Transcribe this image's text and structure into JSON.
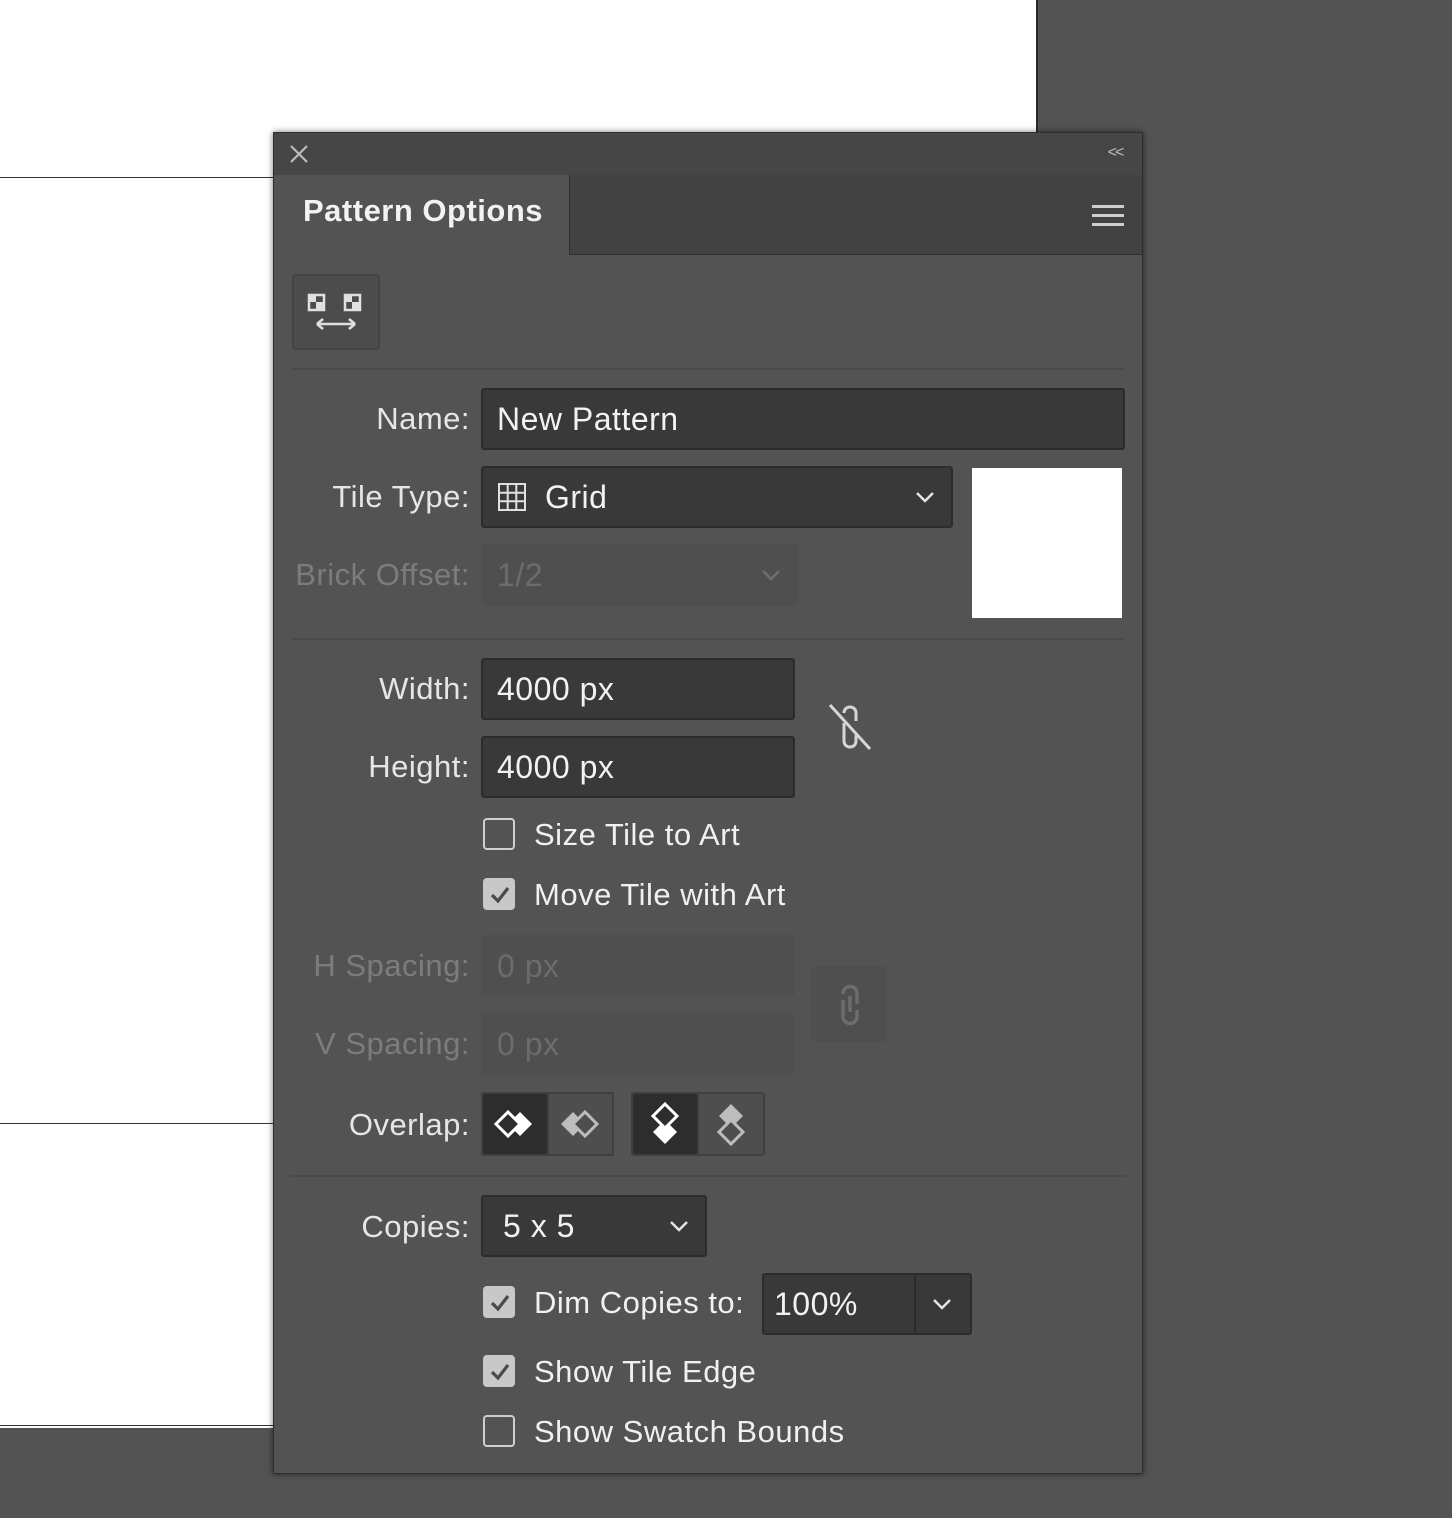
{
  "panel": {
    "title": "Pattern Options",
    "collapse_glyph": "<<",
    "icons": {
      "close": "close-icon",
      "menu": "hamburger-menu-icon",
      "tile_editor": "pattern-tile-tool-icon",
      "tile_type": "grid-icon",
      "size_link": "unlink-chain-icon",
      "spacing_link": "link-chain-icon"
    }
  },
  "form": {
    "name_label": "Name:",
    "name_value": "New Pattern",
    "tile_type_label": "Tile Type:",
    "tile_type_value": "Grid",
    "brick_offset_label": "Brick Offset:",
    "brick_offset_value": "1/2",
    "width_label": "Width:",
    "width_value": "4000 px",
    "height_label": "Height:",
    "height_value": "4000 px",
    "size_tile_to_art": {
      "label": "Size Tile to Art",
      "checked": false
    },
    "move_tile_with_art": {
      "label": "Move Tile with Art",
      "checked": true
    },
    "h_spacing_label": "H Spacing:",
    "h_spacing_value": "0 px",
    "v_spacing_label": "V Spacing:",
    "v_spacing_value": "0 px",
    "overlap_label": "Overlap:",
    "copies_label": "Copies:",
    "copies_value": "5 x 5",
    "dim_copies": {
      "label": "Dim Copies to:",
      "checked": true,
      "value": "100%"
    },
    "show_tile_edge": {
      "label": "Show Tile Edge",
      "checked": true
    },
    "show_swatch_bounds": {
      "label": "Show Swatch Bounds",
      "checked": false
    }
  },
  "colors": {
    "panel_bg": "#535353",
    "field_bg": "#393939",
    "canvas": "#ffffff"
  }
}
